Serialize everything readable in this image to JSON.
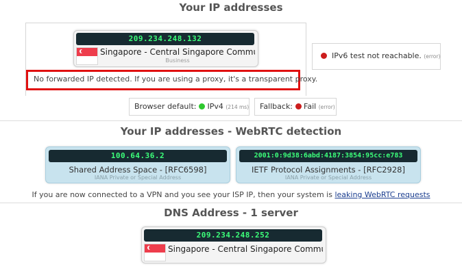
{
  "title_main": "Your IP addresses",
  "main": {
    "ip": "209.234.248.132",
    "location": "Singapore - Central Singapore Community D",
    "isp_type": "Business",
    "forwarded_msg": "No forwarded IP detected. If you are using a proxy, it's a transparent proxy."
  },
  "ipv6": {
    "label": "IPv6 test not reachable.",
    "note": "(error)",
    "status_color": "#cc1d1d"
  },
  "browser_default": {
    "label": "Browser default:",
    "value": "IPv4",
    "note": "(214 ms)",
    "status_color": "#2ec82e"
  },
  "fallback": {
    "label": "Fallback:",
    "value": "Fail",
    "note": "(error)",
    "status_color": "#cc1d1d"
  },
  "title_webrtc": "Your IP addresses - WebRTC detection",
  "webrtc": [
    {
      "ip": "100.64.36.2",
      "label": "Shared Address Space - [RFC6598]",
      "sub": "IANA Private or Special Address"
    },
    {
      "ip": "2001:0:9d38:6abd:4187:3854:95cc:e783",
      "label": "IETF Protocol Assignments - [RFC2928]",
      "sub": "IANA Private or Special Address"
    }
  ],
  "vpn_note": {
    "text": "If you are now connected to a VPN and you see your ISP IP, then your system is ",
    "link": "leaking WebRTC requests"
  },
  "title_dns": "DNS Address - 1 server",
  "dns": {
    "ip": "209.234.248.252",
    "location": "Singapore - Central Singapore Community D"
  },
  "highlight_color": "#e01010"
}
